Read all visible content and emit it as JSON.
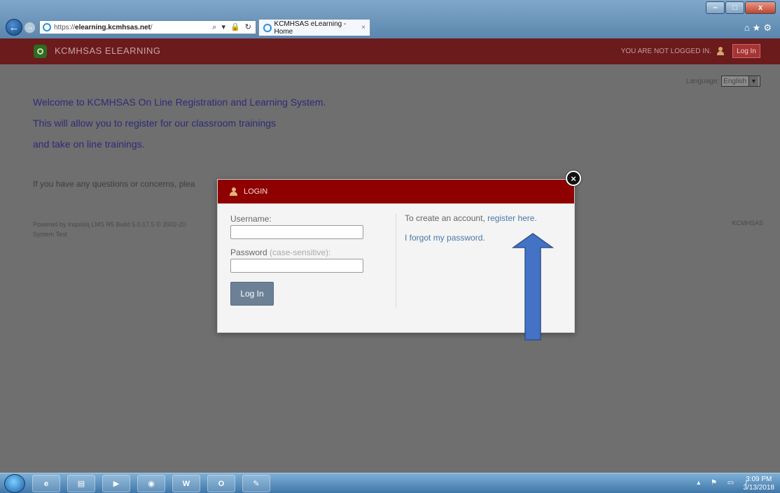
{
  "browser": {
    "url_prefix": "https://",
    "url_host": "elearning.kcmhsas.net",
    "url_suffix": "/",
    "tab_title": "KCMHSAS eLearning - Home",
    "tab_close": "×",
    "addr_tools": "⌕ ▾ 🔒 ↻",
    "right_icons": "⌂★⚙"
  },
  "header": {
    "app_name": "KCMHSAS ELEARNING",
    "not_logged_in": "YOU ARE NOT LOGGED IN.",
    "login_label": "Log In"
  },
  "page": {
    "language_label": "Language:",
    "language_value": "English",
    "welcome_lines": [
      "Welcome to KCMHSAS On Line Registration and Learning System.",
      "This will allow you to register for our classroom trainings",
      "and take on line trainings."
    ],
    "questions_text": "If you have any questions or concerns, plea",
    "powered_line1": "Powered by Inquisiq LMS R5 Build 5.0.17.5 © 2002-20",
    "powered_line2": "System Test",
    "footer_right": "KCMHSAS"
  },
  "modal": {
    "title": "LOGIN",
    "username_label": "Username:",
    "password_label": "Password",
    "password_hint": "(case-sensitive):",
    "login_button": "Log In",
    "create_text": "To create an account,",
    "register_link": "register here.",
    "forgot_link": "I forgot my password.",
    "close_symbol": "×"
  },
  "annotation": {
    "arrow_color": "#4472c4"
  },
  "taskbar": {
    "apps": [
      "ie-icon",
      "file-explorer-icon",
      "media-icon",
      "chrome-icon",
      "word-icon",
      "outlook-icon",
      "paint-icon"
    ],
    "app_labels": [
      "e",
      "▤",
      "▶",
      "◉",
      "W",
      "O",
      "✎"
    ],
    "tray_icons": "▴ ⚑ ▭ ♪",
    "time": "3:09 PM",
    "date": "3/13/2018"
  }
}
